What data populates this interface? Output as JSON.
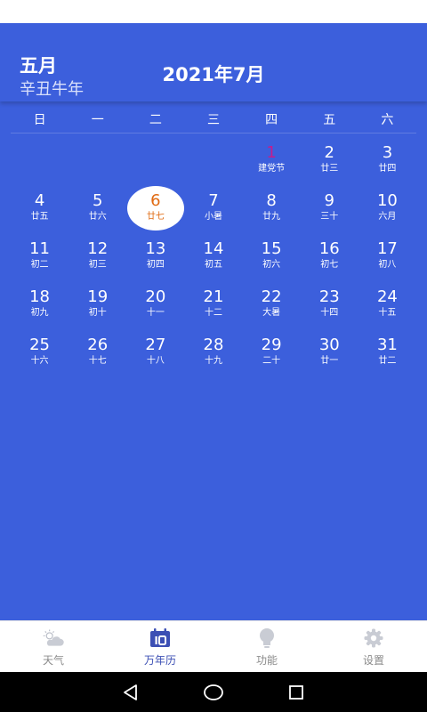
{
  "header": {
    "lunar_month": "五月",
    "lunar_year": "辛丑牛年",
    "title": "2021年7月"
  },
  "weekdays": [
    "日",
    "一",
    "二",
    "三",
    "四",
    "五",
    "六"
  ],
  "leading_blank_days": 4,
  "days": [
    {
      "num": "1",
      "sub": "建党节",
      "festival": true
    },
    {
      "num": "2",
      "sub": "廿三"
    },
    {
      "num": "3",
      "sub": "廿四"
    },
    {
      "num": "4",
      "sub": "廿五"
    },
    {
      "num": "5",
      "sub": "廿六"
    },
    {
      "num": "6",
      "sub": "廿七",
      "selected": true
    },
    {
      "num": "7",
      "sub": "小暑"
    },
    {
      "num": "8",
      "sub": "廿九"
    },
    {
      "num": "9",
      "sub": "三十"
    },
    {
      "num": "10",
      "sub": "六月"
    },
    {
      "num": "11",
      "sub": "初二"
    },
    {
      "num": "12",
      "sub": "初三"
    },
    {
      "num": "13",
      "sub": "初四"
    },
    {
      "num": "14",
      "sub": "初五"
    },
    {
      "num": "15",
      "sub": "初六"
    },
    {
      "num": "16",
      "sub": "初七"
    },
    {
      "num": "17",
      "sub": "初八"
    },
    {
      "num": "18",
      "sub": "初九"
    },
    {
      "num": "19",
      "sub": "初十"
    },
    {
      "num": "20",
      "sub": "十一"
    },
    {
      "num": "21",
      "sub": "十二"
    },
    {
      "num": "22",
      "sub": "大暑"
    },
    {
      "num": "23",
      "sub": "十四"
    },
    {
      "num": "24",
      "sub": "十五"
    },
    {
      "num": "25",
      "sub": "十六"
    },
    {
      "num": "26",
      "sub": "十七"
    },
    {
      "num": "27",
      "sub": "十八"
    },
    {
      "num": "28",
      "sub": "十九"
    },
    {
      "num": "29",
      "sub": "二十"
    },
    {
      "num": "30",
      "sub": "廿一"
    },
    {
      "num": "31",
      "sub": "廿二"
    }
  ],
  "bottom_nav": {
    "items": [
      {
        "label": "天气",
        "icon": "weather-icon"
      },
      {
        "label": "万年历",
        "icon": "calendar-icon",
        "active": true
      },
      {
        "label": "功能",
        "icon": "lightbulb-icon"
      },
      {
        "label": "设置",
        "icon": "gear-icon"
      }
    ]
  },
  "colors": {
    "background": "#3c5fdc",
    "festival": "#c21e8e",
    "selected_text": "#e06a12",
    "nav_active": "#3c4fb4",
    "nav_inactive": "#8a8a8a"
  }
}
